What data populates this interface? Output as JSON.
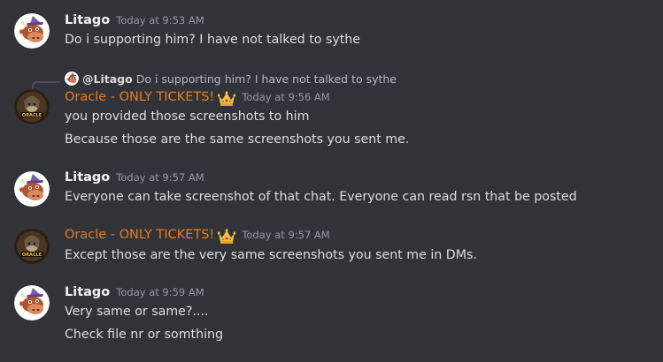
{
  "colors": {
    "background": "#313338",
    "oracle_name": "#e67e22",
    "litago_name": "#f2f3f5",
    "text": "#dbdee1",
    "timestamp": "#949ba4"
  },
  "messages": [
    {
      "author": "Litago",
      "timestamp": "Today at 9:53 AM",
      "lines": [
        "Do i supporting him? I have not talked to sythe"
      ]
    },
    {
      "reply": {
        "author": "@Litago",
        "text": "Do i supporting him? I have not talked to sythe"
      },
      "author": "Oracle - ONLY TICKETS!",
      "author_icon": "crown-icon",
      "timestamp": "Today at 9:56 AM",
      "lines": [
        "you provided those screenshots to him",
        "Because those are the same screenshots you sent me."
      ]
    },
    {
      "author": "Litago",
      "timestamp": "Today at 9:57 AM",
      "lines": [
        "Everyone can take screenshot of that chat. Everyone can read rsn that be posted"
      ]
    },
    {
      "author": "Oracle - ONLY TICKETS!",
      "author_icon": "crown-icon",
      "timestamp": "Today at 9:57 AM",
      "lines": [
        "Except those are the very same screenshots you sent me in DMs."
      ]
    },
    {
      "author": "Litago",
      "timestamp": "Today at 9:59 AM",
      "lines": [
        "Very same or same?....",
        "Check file nr or somthing"
      ]
    }
  ]
}
